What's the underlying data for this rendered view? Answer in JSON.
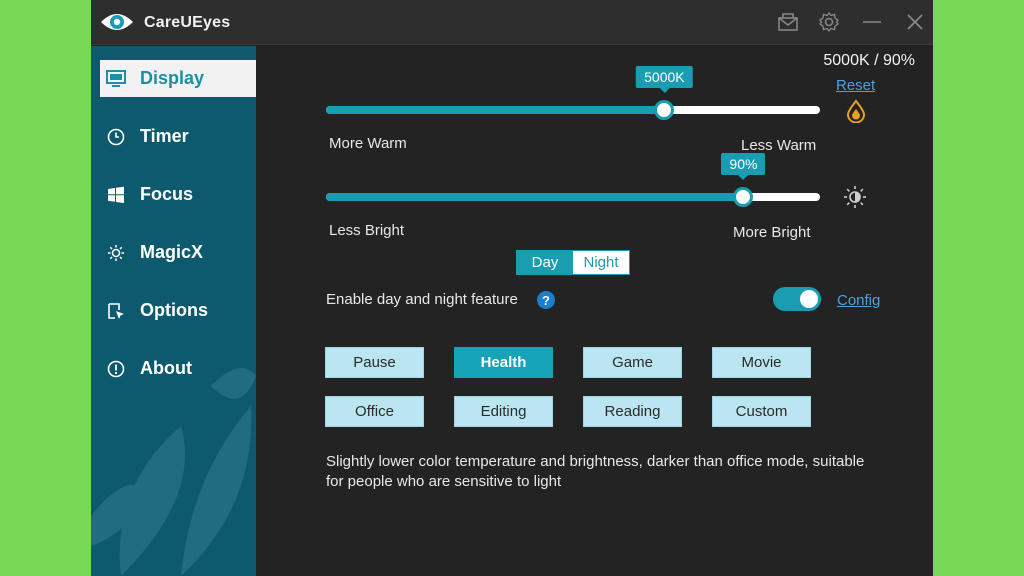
{
  "app": {
    "title": "CareUEyes"
  },
  "titlebar": {
    "icons": [
      "mail-icon",
      "gear-icon",
      "minimize-icon",
      "close-icon"
    ]
  },
  "sidebar": {
    "items": [
      {
        "label": "Display",
        "icon": "monitor-icon",
        "active": true
      },
      {
        "label": "Timer",
        "icon": "clock-icon",
        "active": false
      },
      {
        "label": "Focus",
        "icon": "windows-icon",
        "active": false
      },
      {
        "label": "MagicX",
        "icon": "sparkle-icon",
        "active": false
      },
      {
        "label": "Options",
        "icon": "options-icon",
        "active": false
      },
      {
        "label": "About",
        "icon": "info-icon",
        "active": false
      }
    ]
  },
  "display": {
    "status": "5000K / 90%",
    "reset_label": "Reset",
    "temperature": {
      "value_label": "5000K",
      "fraction": 0.685,
      "min_label": "More Warm",
      "max_label": "Less Warm"
    },
    "brightness": {
      "value_label": "90%",
      "fraction": 0.845,
      "min_label": "Less Bright",
      "max_label": "More Bright"
    },
    "daynight": {
      "day_label": "Day",
      "night_label": "Night",
      "selected": "Day"
    },
    "feature": {
      "label": "Enable day and night feature",
      "help": "?",
      "enabled": true,
      "config_label": "Config"
    },
    "modes": [
      {
        "label": "Pause",
        "active": false
      },
      {
        "label": "Health",
        "active": true
      },
      {
        "label": "Game",
        "active": false
      },
      {
        "label": "Movie",
        "active": false
      },
      {
        "label": "Office",
        "active": false
      },
      {
        "label": "Editing",
        "active": false
      },
      {
        "label": "Reading",
        "active": false
      },
      {
        "label": "Custom",
        "active": false
      }
    ],
    "description": "Slightly lower color temperature and brightness, darker than office mode, suitable for people who are sensitive to light"
  },
  "colors": {
    "accent": "#1a9cb2",
    "sidebar": "#0d5a6e",
    "background": "#232323",
    "link": "#4aa3e0",
    "page": "#78d957"
  }
}
